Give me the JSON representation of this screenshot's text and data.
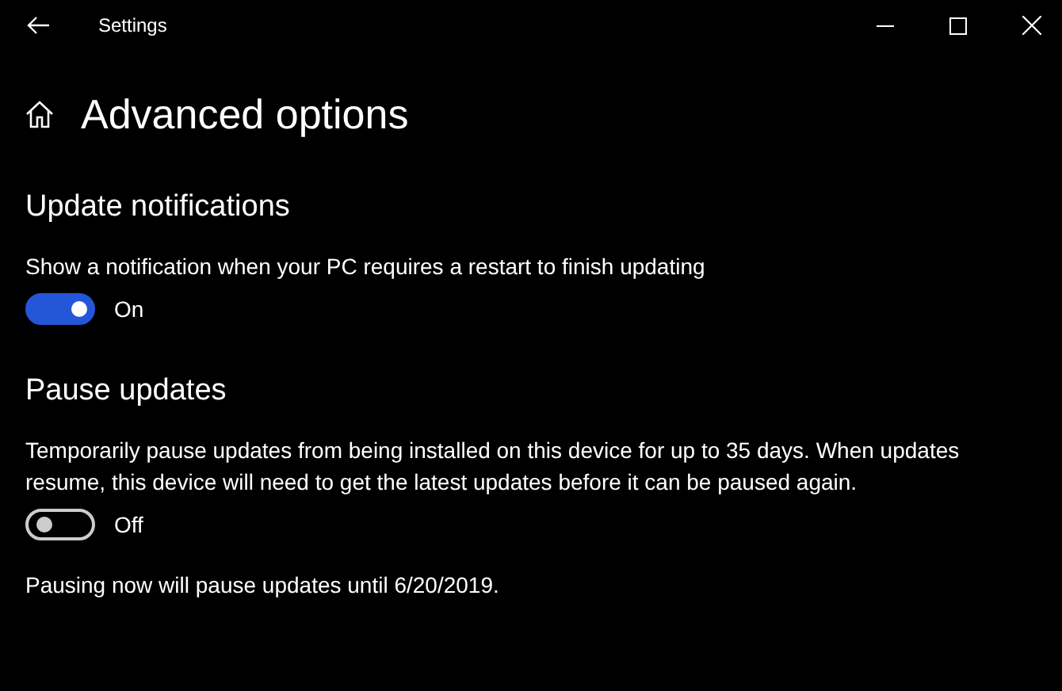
{
  "window": {
    "title": "Settings"
  },
  "page": {
    "title": "Advanced options"
  },
  "sections": [
    {
      "heading": "Update notifications",
      "description": "Show a notification when your PC requires a restart to finish updating",
      "toggle": {
        "on": true,
        "label": "On"
      }
    },
    {
      "heading": "Pause updates",
      "description": "Temporarily pause updates from being installed on this device for up to 35 days. When updates resume, this device will need to get the latest updates before it can be paused again.",
      "toggle": {
        "on": false,
        "label": "Off"
      },
      "note": "Pausing now will pause updates until 6/20/2019."
    }
  ]
}
